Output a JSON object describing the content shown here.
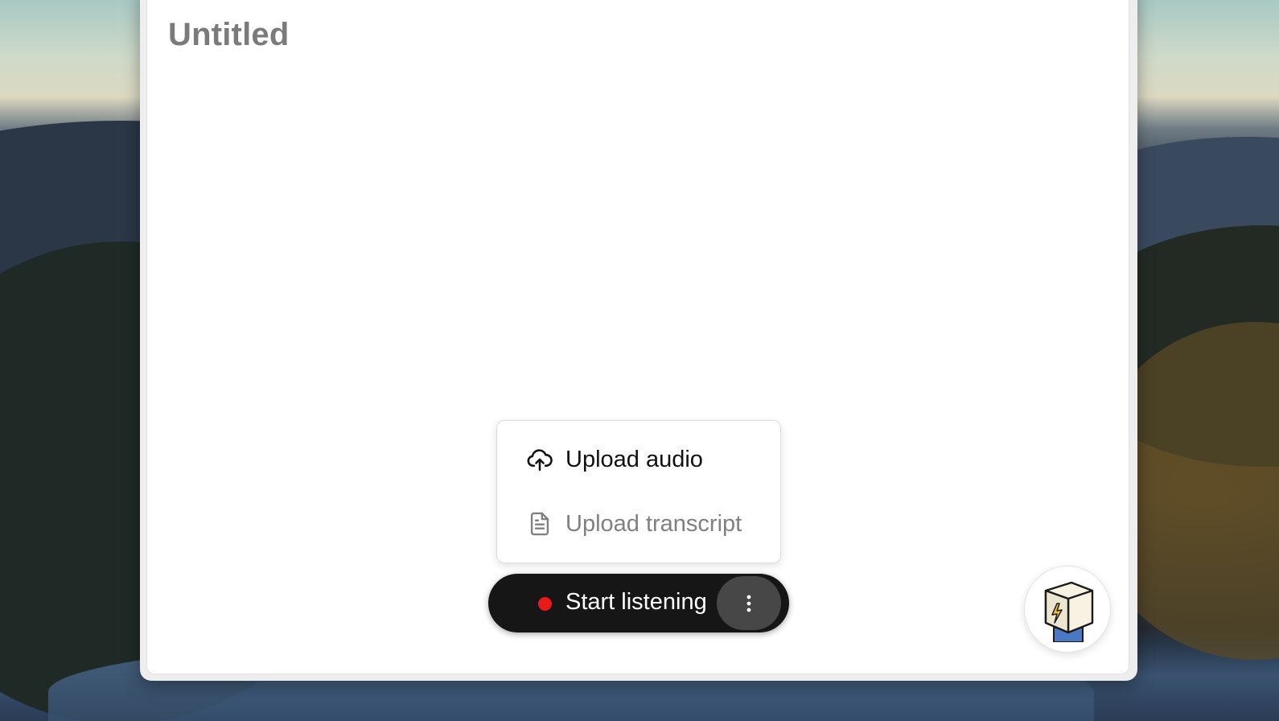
{
  "document": {
    "title": "Untitled"
  },
  "upload_menu": {
    "items": [
      {
        "label": "Upload audio",
        "icon": "cloud-upload-icon",
        "enabled": true
      },
      {
        "label": "Upload transcript",
        "icon": "document-icon",
        "enabled": false
      }
    ]
  },
  "listen_control": {
    "label": "Start listening",
    "status_icon": "record-dot-icon",
    "more_icon": "more-vertical-icon"
  },
  "assistant": {
    "icon": "assistant-cube-avatar-icon"
  },
  "colors": {
    "record_dot": "#ea1a1a",
    "pill_background": "#161616",
    "title_text": "#7b7b7b",
    "disabled_text": "#808080"
  }
}
